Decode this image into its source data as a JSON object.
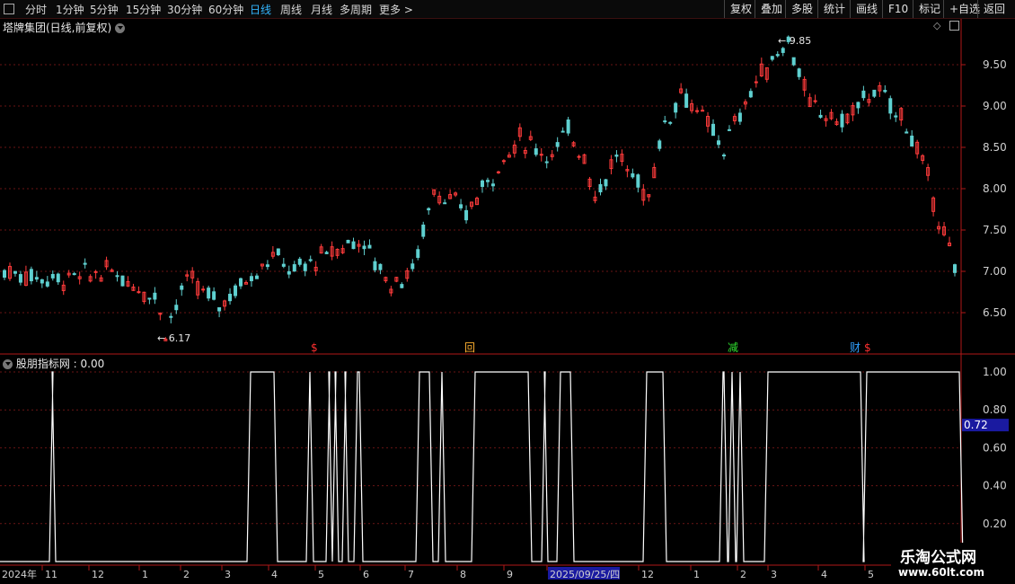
{
  "toolbar": {
    "periods": [
      "分时",
      "1分钟",
      "5分钟",
      "15分钟",
      "30分钟",
      "60分钟",
      "日线",
      "周线",
      "月线",
      "多周期",
      "更多 >"
    ],
    "active_period": "日线",
    "right_buttons": [
      "复权",
      "叠加",
      "多股",
      "统计",
      "画线",
      "F10",
      "标记",
      "+自选",
      "返回"
    ]
  },
  "main_chart": {
    "title": "塔牌集团(日线,前复权)",
    "high_label": "9.85",
    "low_label": "6.17",
    "price_ticks": [
      "9.50",
      "9.00",
      "8.50",
      "8.00",
      "7.50",
      "7.00",
      "6.50"
    ],
    "event_markers": [
      {
        "text": "$",
        "color": "#ff3030"
      },
      {
        "text": "回",
        "color": "#ffb030"
      },
      {
        "text": "减",
        "color": "#30e030"
      },
      {
        "text": "财",
        "color": "#30a0ff"
      },
      {
        "text": "$",
        "color": "#ff3030"
      }
    ],
    "colors": {
      "up": "#ff3b3b",
      "down": "#5fd0d0",
      "grid": "#6a1515",
      "axis": "#b01818"
    }
  },
  "indicator": {
    "title": "股朋指标网 : 0.00",
    "ticks": [
      "1.00",
      "0.80",
      "0.60",
      "0.40",
      "0.20"
    ],
    "current_value": "0.72",
    "line_color": "#ffffff",
    "highlight_color": "#1a1aa0"
  },
  "time_axis": {
    "labels": [
      "2024年",
      "11",
      "12",
      "1",
      "2",
      "3",
      "4",
      "5",
      "6",
      "7",
      "8",
      "9",
      "2025/09/25/四",
      "12",
      "1",
      "2",
      "3",
      "4",
      "5"
    ]
  },
  "watermark": {
    "line1": "乐淘公式网",
    "line2": "www.60lt.com"
  },
  "chart_data": {
    "type": "line",
    "title": "股朋指标网",
    "series": [
      {
        "name": "股朋指标网",
        "values": [
          0,
          1,
          0,
          1,
          0,
          1,
          0,
          1,
          0,
          1,
          0,
          1,
          0,
          1,
          0,
          1,
          0,
          1,
          0,
          1,
          0,
          1,
          0,
          1,
          0,
          1,
          0,
          1,
          0,
          1,
          0,
          1,
          0,
          1,
          0
        ]
      }
    ],
    "ylim": [
      0,
      1.0
    ],
    "price_range": [
      6.17,
      9.85
    ]
  }
}
